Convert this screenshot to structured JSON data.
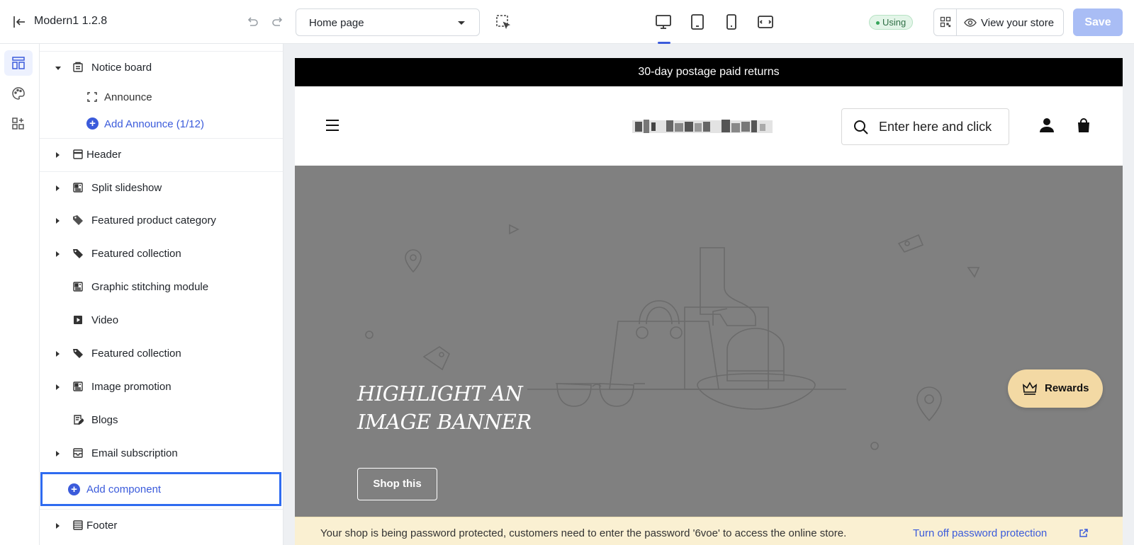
{
  "topbar": {
    "app_title": "Modern1  1.2.8",
    "page_select": "Home page",
    "status_badge": "Using",
    "view_store_label": "View your store",
    "save_label": "Save",
    "accent_color": "#3b5bdb"
  },
  "rail": {
    "items": [
      "sections-icon",
      "theme-style-icon",
      "apps-icon"
    ],
    "active": "sections-icon"
  },
  "sidebar": {
    "notice_board": "Notice board",
    "announce": "Announce",
    "add_announce": "Add Announce (1/12)",
    "sections": [
      "Header",
      "Split slideshow",
      "Featured product category",
      "Featured collection",
      "Graphic stitching module",
      "Video",
      "Featured collection",
      "Image promotion",
      "Blogs",
      "Email subscription"
    ],
    "add_component": "Add component",
    "footer": "Footer"
  },
  "preview": {
    "announcement": "30-day postage paid returns",
    "search_placeholder": "Enter here and click",
    "banner_heading_line1": "HIGHLIGHT AN",
    "banner_heading_line2": "IMAGE BANNER",
    "shop_button": "Shop this",
    "rewards_label": "Rewards",
    "rewards_color": "#f3d9a4",
    "password_notice": "Your shop is being password protected, customers need to enter the password '6voe' to access the online store.",
    "password_link": "Turn off password protection"
  }
}
